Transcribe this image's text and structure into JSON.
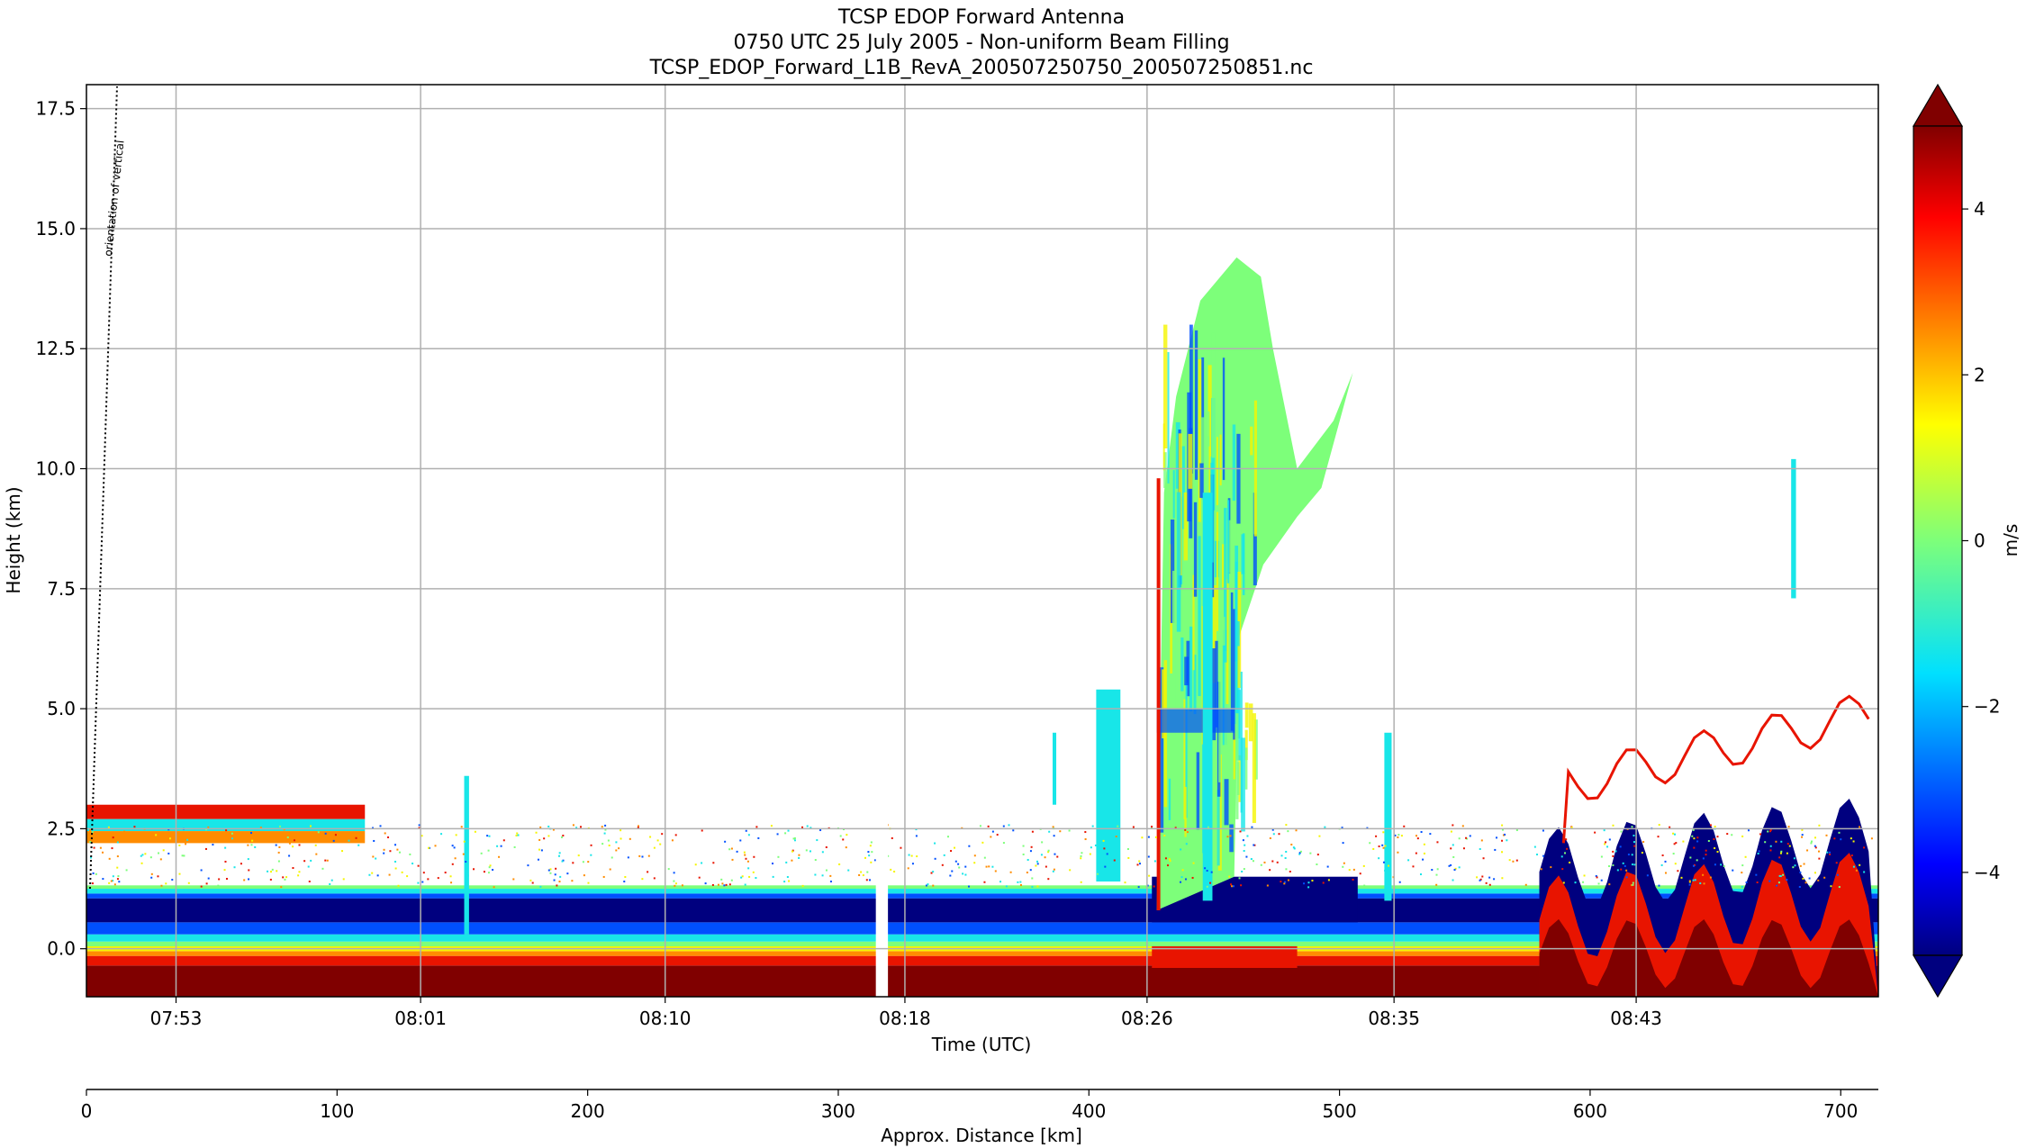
{
  "chart_data": {
    "type": "heatmap",
    "title": [
      "TCSP EDOP Forward Antenna",
      "0750 UTC 25 July 2005 - Non-uniform Beam Filling",
      "TCSP_EDOP_Forward_L1B_RevA_200507250750_200507250851.nc"
    ],
    "xlabel": "Time (UTC)",
    "ylabel": "Height (km)",
    "x2label": "Approx. Distance [km]",
    "colorbar_label": "m/s",
    "annotation": "orientation of vertical",
    "xlim_min": [
      0,
      74
    ],
    "ylim": [
      -1,
      18
    ],
    "x2lim": [
      0,
      715
    ],
    "clim": [
      -5,
      5
    ],
    "colormap": "jet",
    "grid": true,
    "x_ticks": [
      {
        "label": "07:53",
        "min": 3.7
      },
      {
        "label": "08:01",
        "min": 13.8
      },
      {
        "label": "08:10",
        "min": 23.9
      },
      {
        "label": "08:18",
        "min": 33.8
      },
      {
        "label": "08:26",
        "min": 43.8
      },
      {
        "label": "08:35",
        "min": 54.0
      },
      {
        "label": "08:43",
        "min": 64.0
      }
    ],
    "y_ticks": [
      {
        "label": "0.0",
        "v": 0
      },
      {
        "label": "2.5",
        "v": 2.5
      },
      {
        "label": "5.0",
        "v": 5
      },
      {
        "label": "7.5",
        "v": 7.5
      },
      {
        "label": "10.0",
        "v": 10
      },
      {
        "label": "12.5",
        "v": 12.5
      },
      {
        "label": "15.0",
        "v": 15
      },
      {
        "label": "17.5",
        "v": 17.5
      }
    ],
    "x2_ticks": [
      {
        "label": "0",
        "v": 0
      },
      {
        "label": "100",
        "v": 100
      },
      {
        "label": "200",
        "v": 200
      },
      {
        "label": "300",
        "v": 300
      },
      {
        "label": "400",
        "v": 400
      },
      {
        "label": "500",
        "v": 500
      },
      {
        "label": "600",
        "v": 600
      },
      {
        "label": "700",
        "v": 700
      }
    ],
    "cbar_ticks": [
      {
        "label": "4",
        "v": 4
      },
      {
        "label": "2",
        "v": 2
      },
      {
        "label": "0",
        "v": 0
      },
      {
        "label": "−2",
        "v": -2
      },
      {
        "label": "−4",
        "v": -4
      }
    ],
    "colors": {
      "dark_red": "#800000",
      "red": "#e81400",
      "orange": "#ff8c00",
      "yellow": "#f5f500",
      "green": "#7dff7a",
      "cyan": "#18e6e8",
      "blue": "#0050ff",
      "navy": "#00007f"
    }
  }
}
